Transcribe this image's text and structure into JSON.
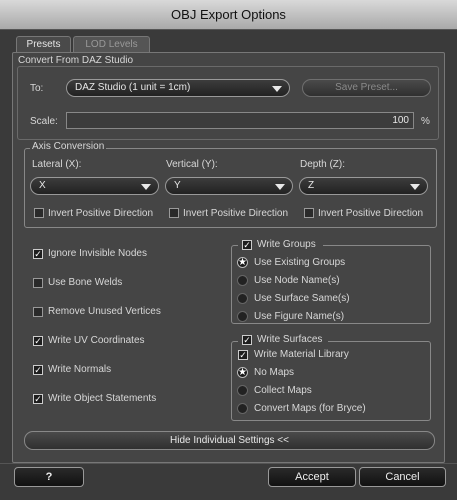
{
  "window": {
    "title": "OBJ Export Options"
  },
  "tabs": [
    {
      "label": "Presets",
      "active": true
    },
    {
      "label": "LOD Levels",
      "active": false
    }
  ],
  "convert": {
    "group_label": "Convert From DAZ Studio",
    "to_label": "To:",
    "to_value": "DAZ Studio (1 unit = 1cm)",
    "save_preset_label": "Save Preset...",
    "scale_label": "Scale:",
    "scale_value": "100",
    "scale_unit": "%"
  },
  "axis": {
    "group_label": "Axis Conversion",
    "lateral": {
      "label": "Lateral (X):",
      "value": "X",
      "invert_label": "Invert Positive Direction",
      "invert_checked": false
    },
    "vertical": {
      "label": "Vertical (Y):",
      "value": "Y",
      "invert_label": "Invert Positive Direction",
      "invert_checked": false
    },
    "depth": {
      "label": "Depth (Z):",
      "value": "Z",
      "invert_label": "Invert Positive Direction",
      "invert_checked": false
    }
  },
  "options": [
    {
      "label": "Ignore Invisible Nodes",
      "checked": true
    },
    {
      "label": "Use Bone Welds",
      "checked": false
    },
    {
      "label": "Remove Unused Vertices",
      "checked": false
    },
    {
      "label": "Write UV Coordinates",
      "checked": true
    },
    {
      "label": "Write Normals",
      "checked": true
    },
    {
      "label": "Write Object Statements",
      "checked": true
    }
  ],
  "write_groups": {
    "label": "Write Groups",
    "checked": true,
    "options": [
      {
        "label": "Use Existing Groups",
        "selected": true
      },
      {
        "label": "Use Node Name(s)",
        "selected": false
      },
      {
        "label": "Use Surface Same(s)",
        "selected": false
      },
      {
        "label": "Use Figure Name(s)",
        "selected": false
      }
    ]
  },
  "write_surfaces": {
    "label": "Write Surfaces",
    "checked": true,
    "material_library_label": "Write Material Library",
    "material_library_checked": true,
    "options": [
      {
        "label": "No Maps",
        "selected": true
      },
      {
        "label": "Collect Maps",
        "selected": false
      },
      {
        "label": "Convert Maps (for Bryce)",
        "selected": false
      }
    ]
  },
  "hide_settings_label": "Hide Individual Settings <<",
  "footer": {
    "help_glyph": "?",
    "accept_label": "Accept",
    "cancel_label": "Cancel"
  }
}
